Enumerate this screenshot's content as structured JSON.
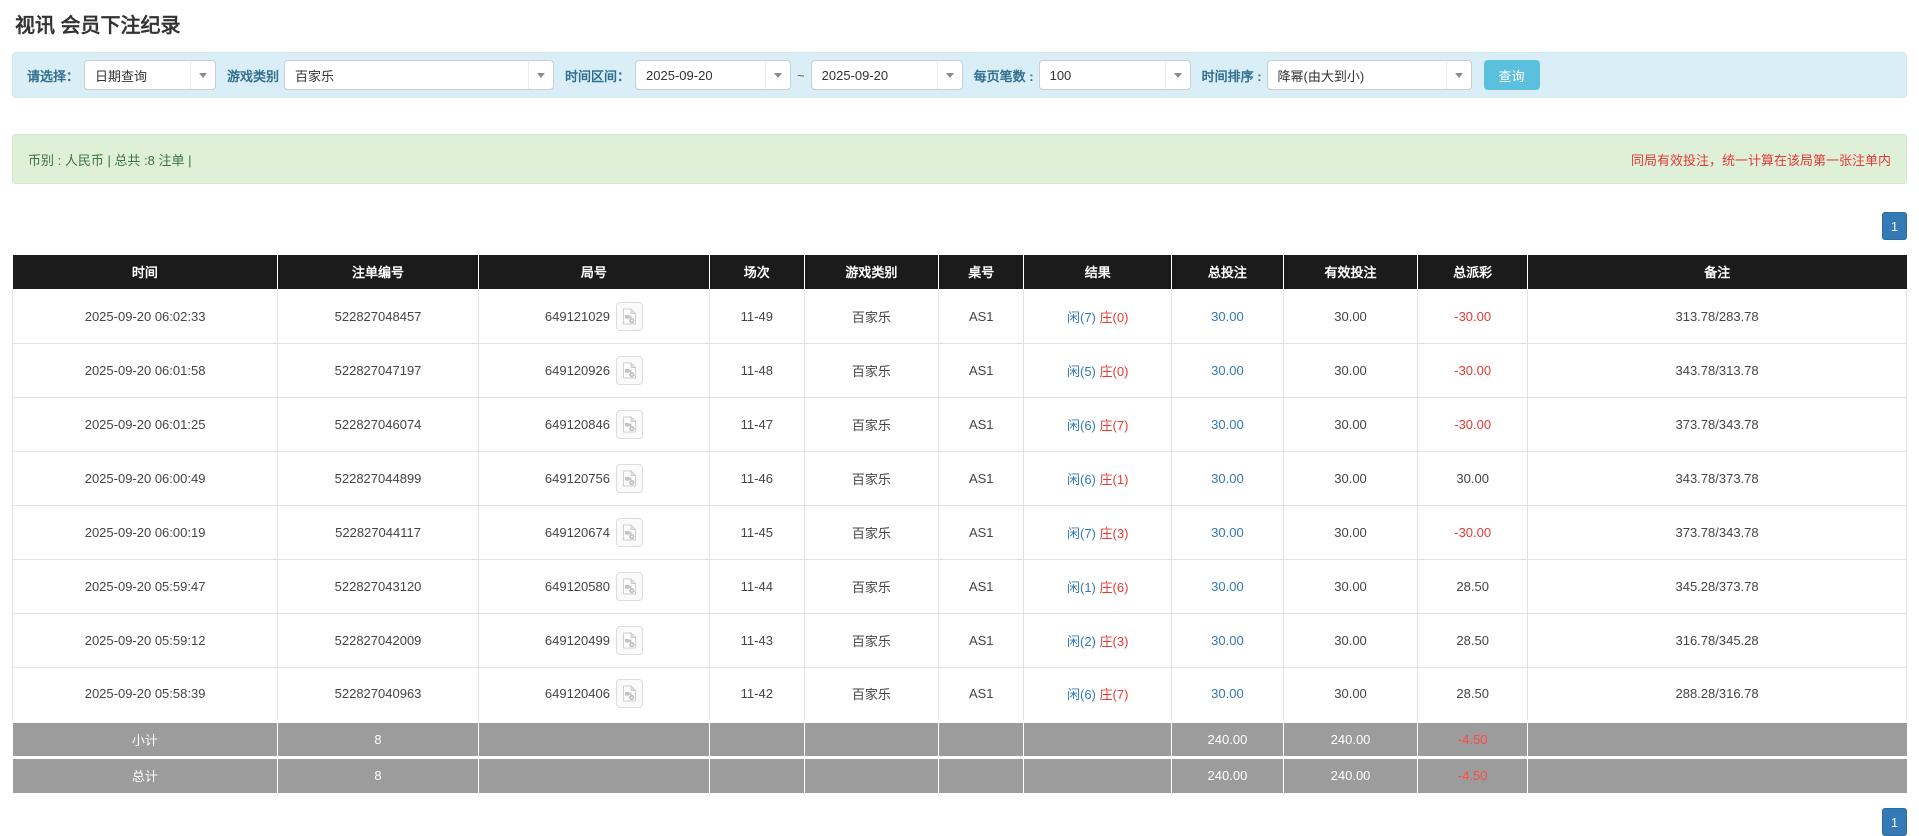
{
  "page": {
    "title": "视讯 会员下注纪录"
  },
  "filters": {
    "select_label": "请选择：",
    "select_value": "日期查询",
    "game_label": "游戏类别",
    "game_value": "百家乐",
    "range_label": "时间区间：",
    "date_from": "2025-09-20",
    "range_separator": "~",
    "date_to": "2025-09-20",
    "page_size_label": "每页笔数 :",
    "page_size_value": "100",
    "sort_label": "时间排序 :",
    "sort_value": "降幂(由大到小)",
    "search_button": "查询"
  },
  "summary": {
    "left": "币别 : 人民币 | 总共 :8 注单 |",
    "right_note": "同局有效投注，统一计算在该局第一张注单内"
  },
  "pagination": {
    "page": "1"
  },
  "table": {
    "headers": [
      "时间",
      "注单编号",
      "局号",
      "场次",
      "游戏类别",
      "桌号",
      "结果",
      "总投注",
      "有效投注",
      "总派彩",
      "备注"
    ],
    "rows": [
      {
        "time": "2025-09-20 06:02:33",
        "bet_id": "522827048457",
        "round_id": "649121029",
        "session": "11-49",
        "game": "百家乐",
        "table_no": "AS1",
        "result_player": "闲(7)",
        "result_banker": "庄(0)",
        "total_bet": "30.00",
        "valid_bet": "30.00",
        "payout": "-30.00",
        "remark": "313.78/283.78"
      },
      {
        "time": "2025-09-20 06:01:58",
        "bet_id": "522827047197",
        "round_id": "649120926",
        "session": "11-48",
        "game": "百家乐",
        "table_no": "AS1",
        "result_player": "闲(5)",
        "result_banker": "庄(0)",
        "total_bet": "30.00",
        "valid_bet": "30.00",
        "payout": "-30.00",
        "remark": "343.78/313.78"
      },
      {
        "time": "2025-09-20 06:01:25",
        "bet_id": "522827046074",
        "round_id": "649120846",
        "session": "11-47",
        "game": "百家乐",
        "table_no": "AS1",
        "result_player": "闲(6)",
        "result_banker": "庄(7)",
        "total_bet": "30.00",
        "valid_bet": "30.00",
        "payout": "-30.00",
        "remark": "373.78/343.78"
      },
      {
        "time": "2025-09-20 06:00:49",
        "bet_id": "522827044899",
        "round_id": "649120756",
        "session": "11-46",
        "game": "百家乐",
        "table_no": "AS1",
        "result_player": "闲(6)",
        "result_banker": "庄(1)",
        "total_bet": "30.00",
        "valid_bet": "30.00",
        "payout": "30.00",
        "remark": "343.78/373.78"
      },
      {
        "time": "2025-09-20 06:00:19",
        "bet_id": "522827044117",
        "round_id": "649120674",
        "session": "11-45",
        "game": "百家乐",
        "table_no": "AS1",
        "result_player": "闲(7)",
        "result_banker": "庄(3)",
        "total_bet": "30.00",
        "valid_bet": "30.00",
        "payout": "-30.00",
        "remark": "373.78/343.78"
      },
      {
        "time": "2025-09-20 05:59:47",
        "bet_id": "522827043120",
        "round_id": "649120580",
        "session": "11-44",
        "game": "百家乐",
        "table_no": "AS1",
        "result_player": "闲(1)",
        "result_banker": "庄(6)",
        "total_bet": "30.00",
        "valid_bet": "30.00",
        "payout": "28.50",
        "remark": "345.28/373.78"
      },
      {
        "time": "2025-09-20 05:59:12",
        "bet_id": "522827042009",
        "round_id": "649120499",
        "session": "11-43",
        "game": "百家乐",
        "table_no": "AS1",
        "result_player": "闲(2)",
        "result_banker": "庄(3)",
        "total_bet": "30.00",
        "valid_bet": "30.00",
        "payout": "28.50",
        "remark": "316.78/345.28"
      },
      {
        "time": "2025-09-20 05:58:39",
        "bet_id": "522827040963",
        "round_id": "649120406",
        "session": "11-42",
        "game": "百家乐",
        "table_no": "AS1",
        "result_player": "闲(6)",
        "result_banker": "庄(7)",
        "total_bet": "30.00",
        "valid_bet": "30.00",
        "payout": "28.50",
        "remark": "288.28/316.78"
      }
    ],
    "subtotal": {
      "label": "小计",
      "count": "8",
      "total_bet": "240.00",
      "valid_bet": "240.00",
      "payout": "-4.50"
    },
    "total": {
      "label": "总计",
      "count": "8",
      "total_bet": "240.00",
      "valid_bet": "240.00",
      "payout": "-4.50"
    }
  },
  "colors": {
    "label_blue": "#31708f",
    "accent_button": "#5bc0de",
    "link_blue": "#337ab7",
    "red": "#e53935",
    "green_bar_bg": "#dff0d8",
    "green_text": "#3c763d",
    "table_header_bg": "#1b1b1b",
    "summary_row_bg": "#9c9c9c"
  }
}
